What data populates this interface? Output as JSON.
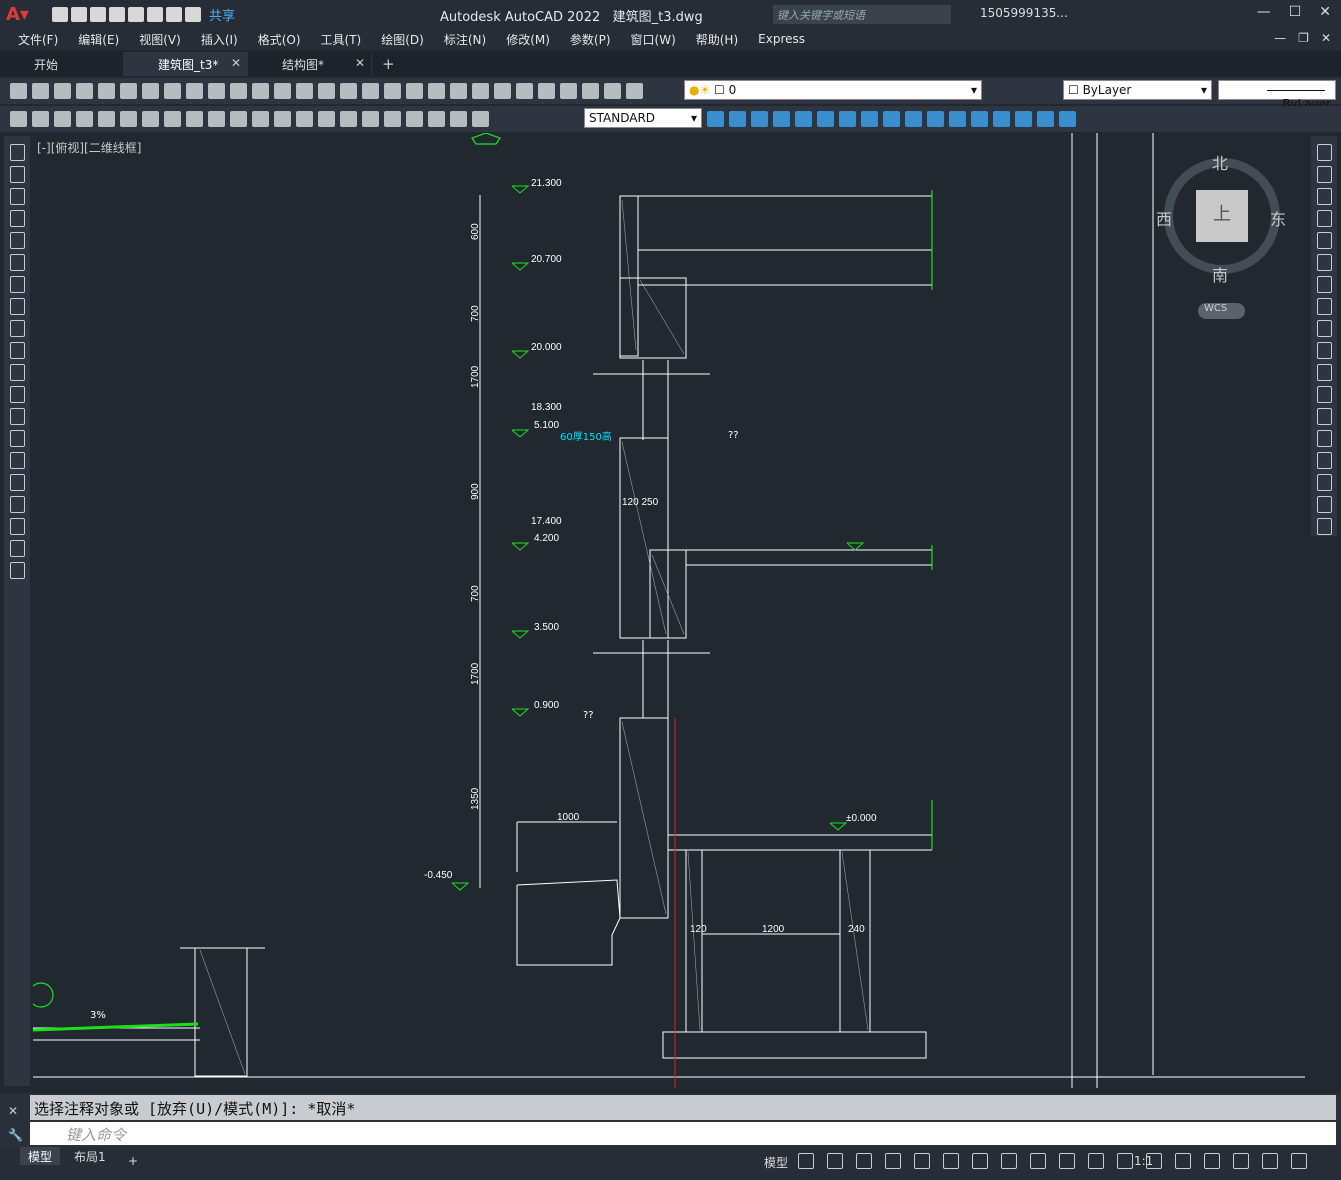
{
  "app": {
    "title": "Autodesk AutoCAD 2022",
    "file": "建筑图_t3.dwg",
    "share": "共享",
    "search_placeholder": "键入关键字或短语",
    "user": "1505999135..."
  },
  "menu": [
    "文件(F)",
    "编辑(E)",
    "视图(V)",
    "插入(I)",
    "格式(O)",
    "工具(T)",
    "绘图(D)",
    "标注(N)",
    "修改(M)",
    "参数(P)",
    "窗口(W)",
    "帮助(H)",
    "Express"
  ],
  "tabs": [
    {
      "label": "开始"
    },
    {
      "label": "建筑图_t3*"
    },
    {
      "label": "结构图*"
    }
  ],
  "layer": {
    "current": "0",
    "color": "ByLayer",
    "linetype": "ByLayer",
    "textstyle": "STANDARD"
  },
  "viewport": {
    "label": "[-][俯视][二维线框]"
  },
  "viewcube": {
    "north": "北",
    "south": "南",
    "east": "东",
    "west": "西",
    "top": "上",
    "wcs": "WCS"
  },
  "drawing": {
    "levels": [
      "21.300",
      "20.700",
      "20.000",
      "18.300",
      "5.100",
      "17.400",
      "4.200",
      "3.500",
      "0.900",
      "-0.450",
      "±0.000"
    ],
    "dims": [
      "600",
      "700",
      "1700",
      "900",
      "700",
      "1700",
      "1350",
      "1000",
      "1200",
      "120",
      "240",
      "120 250"
    ],
    "notes": [
      "60厚150高",
      "??",
      "??",
      "3%"
    ]
  },
  "command": {
    "history": "选择注释对象或 [放弃(U)/模式(M)]: *取消*",
    "placeholder": "键入命令"
  },
  "status": {
    "tabs": [
      "模型",
      "布局1"
    ],
    "model": "模型",
    "scale": "1:1"
  },
  "colors": {
    "bg": "#212830",
    "line": "#ffffff",
    "cyan": "#00e5ff",
    "green": "#19e219",
    "red": "#e02020"
  }
}
